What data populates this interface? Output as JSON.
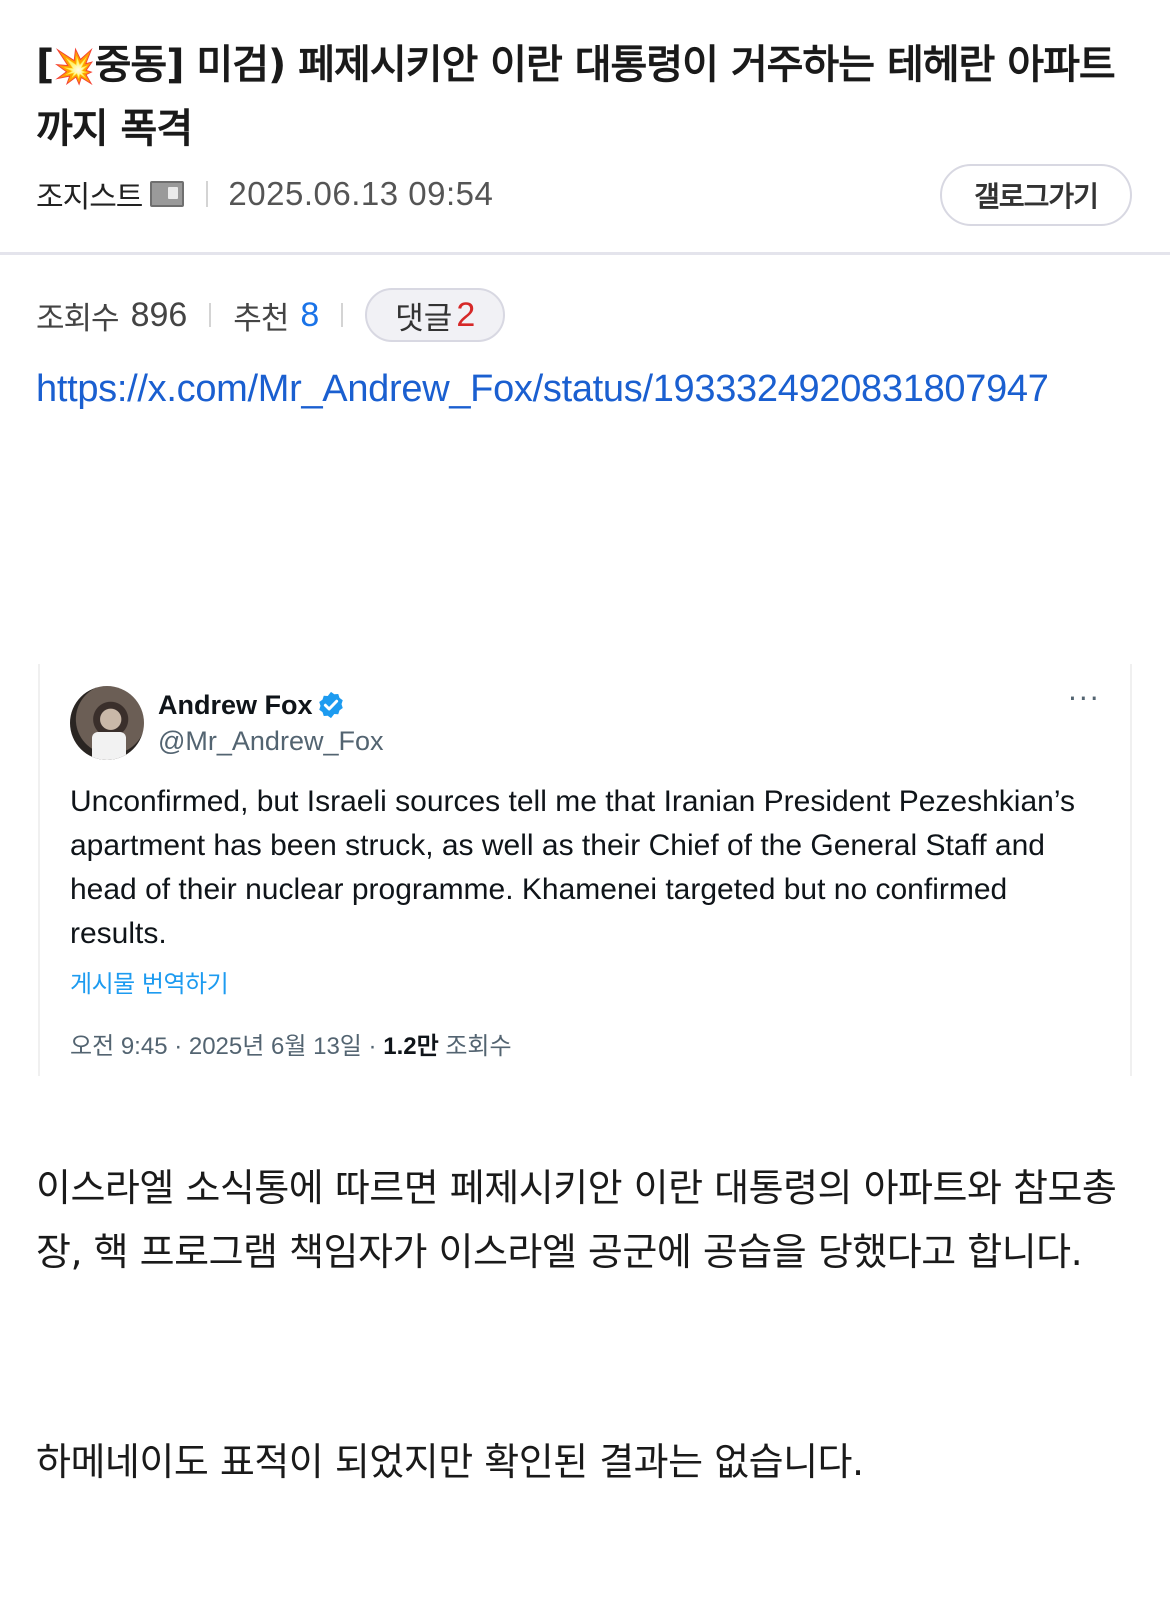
{
  "post": {
    "title_prefix": "[",
    "title_emoji": "💥",
    "title_text": "중동] 미검) 페제시키안 이란 대통령이 거주하는 테헤란 아파트까지 폭격",
    "author": "조지스트",
    "date": "2025.06.13 09:54",
    "gallery_button": "갤로그가기"
  },
  "stats": {
    "views_label": "조회수",
    "views": "896",
    "recommend_label": "추천",
    "recommend": "8",
    "comments_label": "댓글",
    "comments": "2"
  },
  "link": "https://x.com/Mr_Andrew_Fox/status/1933324920831807947",
  "tweet": {
    "name": "Andrew Fox",
    "handle": "@Mr_Andrew_Fox",
    "more": "···",
    "text": "Unconfirmed, but Israeli sources tell me that Iranian President Pezeshkian’s apartment has been struck, as well as their Chief of the General Staff and head of their nuclear programme. Khamenei targeted but no confirmed results.",
    "translate": "게시물 번역하기",
    "footer_time": "오전 9:45 · 2025년 6월 13일 · ",
    "footer_views": "1.2만",
    "footer_views_label": " 조회수"
  },
  "body": {
    "paragraph1": "이스라엘 소식통에 따르면 페제시키안 이란 대통령의 아파트와 참모총장, 핵 프로그램 책임자가 이스라엘 공군에 공습을 당했다고 합니다.",
    "paragraph2": "하메네이도 표적이 되었지만 확인된 결과는 없습니다."
  },
  "colors": {
    "link": "#1a5fd0",
    "recommend": "#1a73e8",
    "comment_count": "#d62828",
    "verified_badge": "#1d9bf0",
    "translate": "#1d9bf0"
  }
}
